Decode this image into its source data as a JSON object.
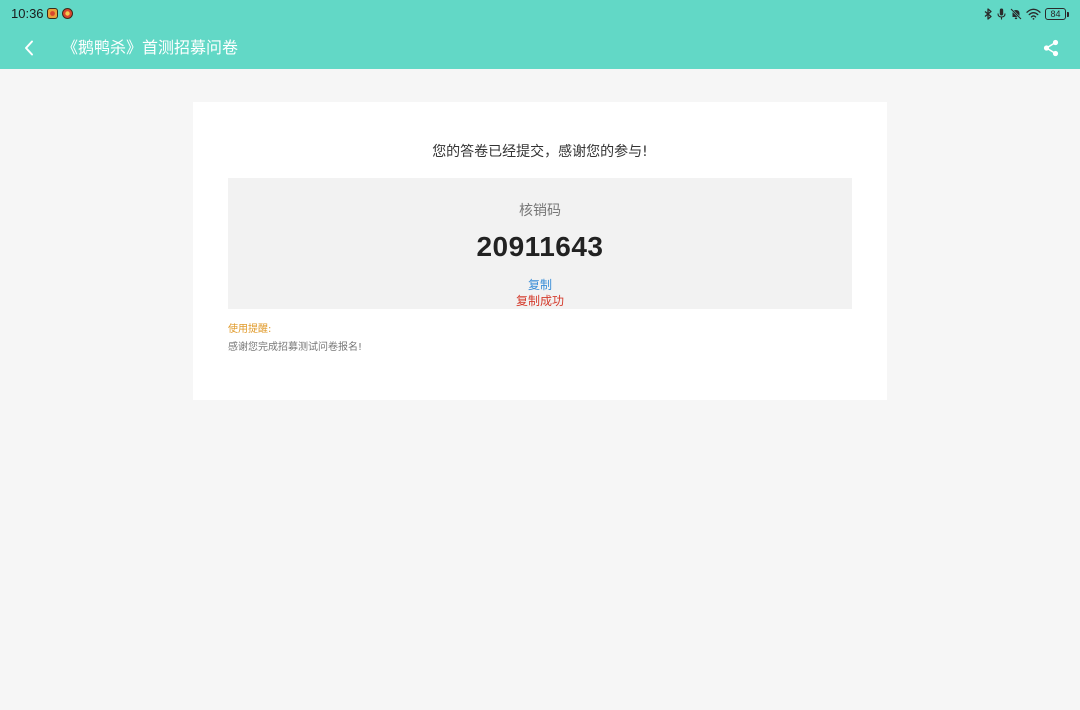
{
  "status_bar": {
    "time": "10:36",
    "battery_level": "84",
    "icons": [
      "app-notification-icon",
      "app-notification-icon",
      "bluetooth-icon",
      "microphone-icon",
      "mute-icon",
      "wifi-icon",
      "battery-icon"
    ]
  },
  "app_bar": {
    "title": "《鹅鸭杀》首测招募问卷",
    "back_icon": "chevron-left-icon",
    "share_icon": "share-icon",
    "background_color": "#62d8c6"
  },
  "main": {
    "message": "您的答卷已经提交，感谢您的参与!",
    "code_label": "核销码",
    "code_value": "20911643",
    "copy_label": "复制",
    "copy_success": "复制成功",
    "tip_title": "使用提醒:",
    "tip_text": "感谢您完成招募测试问卷报名!"
  },
  "colors": {
    "link": "#3b8ed8",
    "success": "#d43b2c",
    "tip": "#e09a2a"
  }
}
